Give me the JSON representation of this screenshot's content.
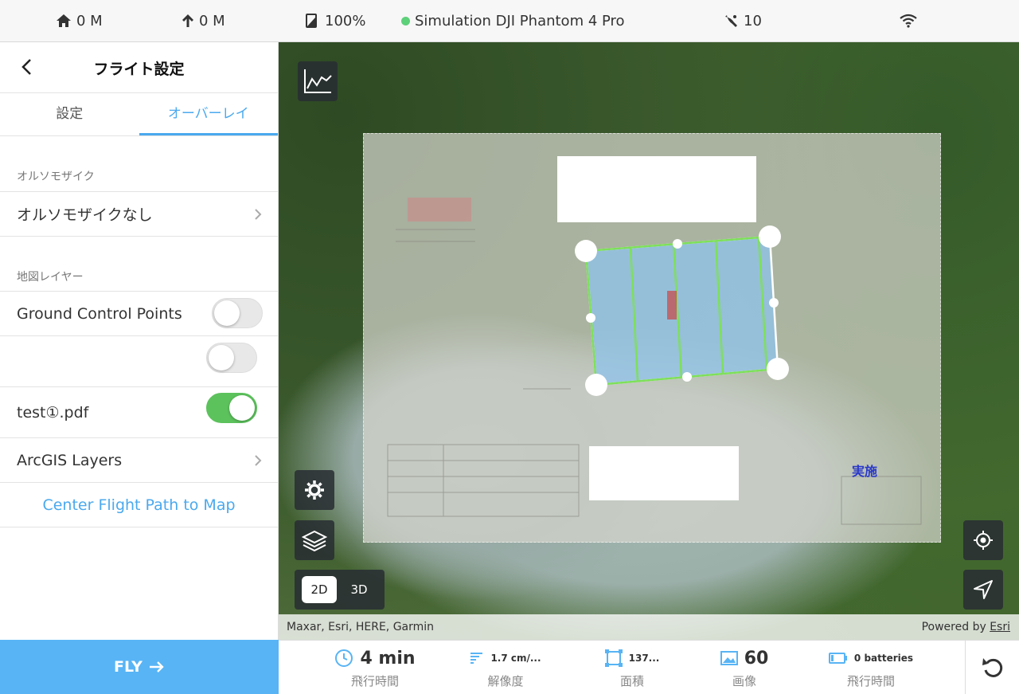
{
  "status_bar": {
    "home_altitude": "0 M",
    "altitude": "0 M",
    "battery": "100%",
    "aircraft": "Simulation DJI Phantom 4 Pro",
    "satellites": "10",
    "connection_color": "#5dd07a"
  },
  "panel": {
    "title": "フライト設定",
    "tabs": [
      {
        "label": "設定",
        "active": false
      },
      {
        "label": "オーバーレイ",
        "active": true
      }
    ],
    "ortho_section_label": "オルソモザイク",
    "ortho_value": "オルソモザイクなし",
    "map_layers_label": "地図レイヤー",
    "layers": [
      {
        "label": "Ground Control Points",
        "enabled": false
      },
      {
        "label": "",
        "enabled": false
      },
      {
        "label": "test①.pdf",
        "enabled": true
      }
    ],
    "arcgis_label": "ArcGIS Layers",
    "center_link": "Center Flight Path to Map"
  },
  "fly_button": "FLY",
  "map": {
    "blue_label": "実施",
    "mode_2d": "2D",
    "mode_3d": "3D",
    "active_mode": "2D",
    "attribution_left": "Maxar, Esri, HERE, Garmin",
    "attribution_powered": "Powered by",
    "attribution_link": "Esri"
  },
  "stats": {
    "time_value": "4 min",
    "time_label": "飛行時間",
    "resolution_value": "1.7 cm/...",
    "resolution_label": "解像度",
    "area_value": "137...",
    "area_label": "面積",
    "images_value": "60",
    "images_label": "画像",
    "batteries_value": "0 batteries",
    "batteries_label": "飛行時間"
  },
  "colors": {
    "accent": "#4aa9ee",
    "fly_button": "#58b4f5",
    "toggle_on": "#5cc25c",
    "flight_area": "#8ec3ee",
    "flight_lines": "#7ee05a"
  }
}
